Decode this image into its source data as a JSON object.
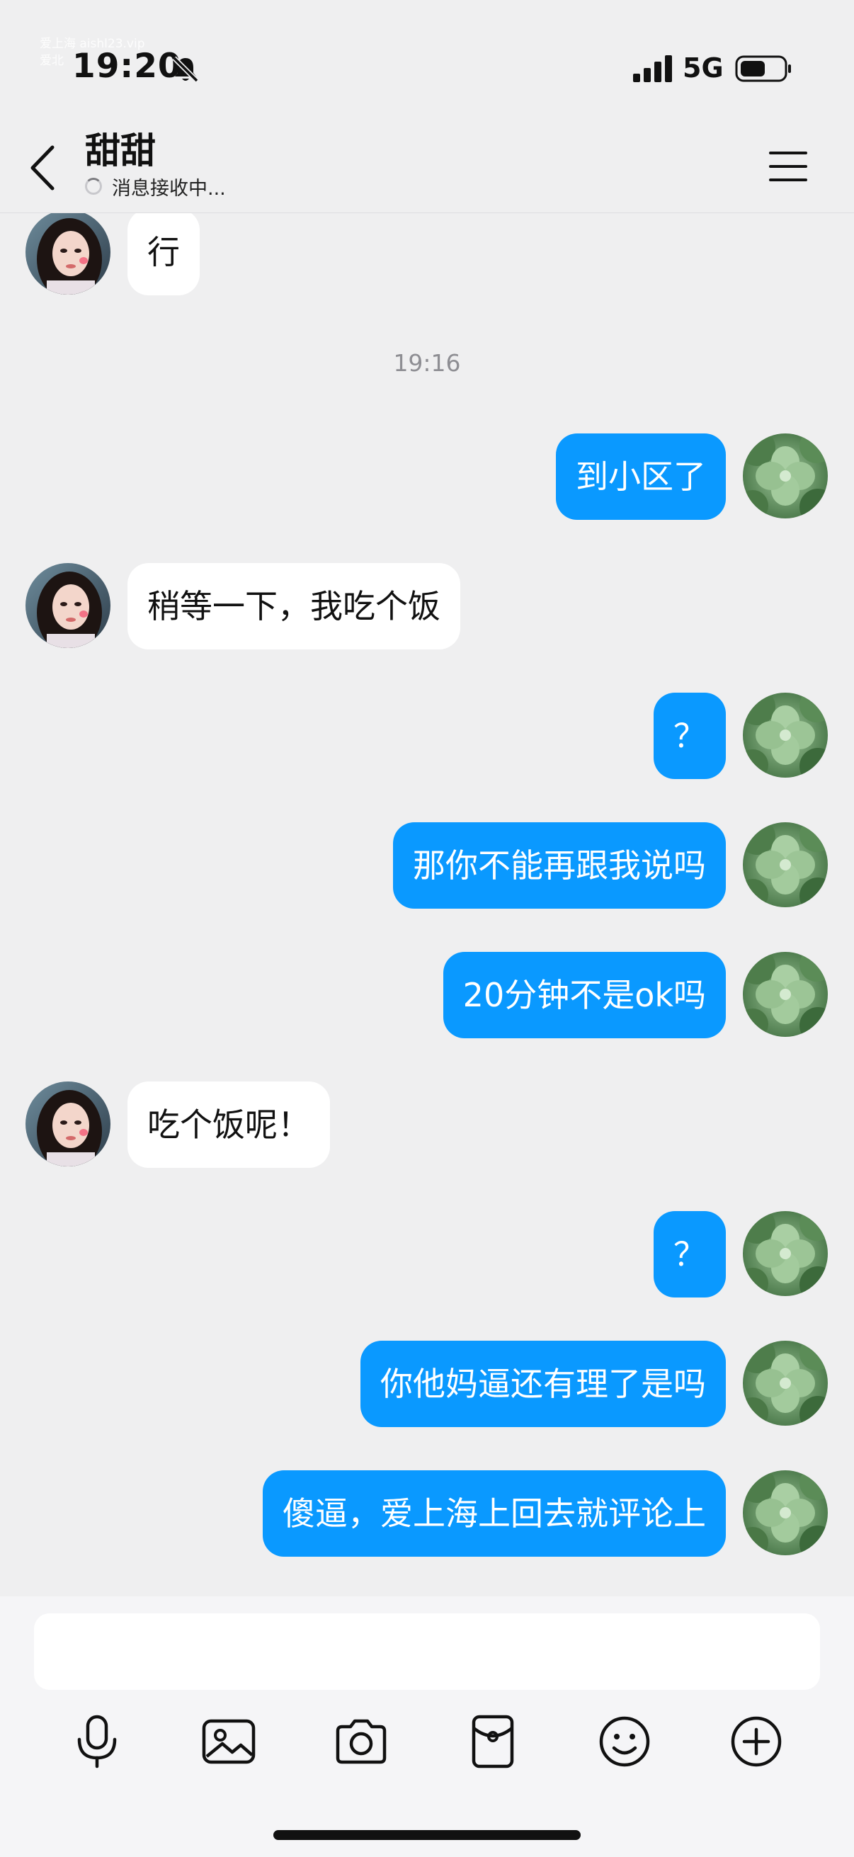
{
  "status_bar": {
    "watermark_line1": "爱上海 aishl23.vip",
    "watermark_line2": "爱北",
    "time": "19:20",
    "network": "5G",
    "bell_icon": "bell-slash-icon",
    "signal_icon": "signal-bars-icon",
    "battery_icon": "battery-icon"
  },
  "header": {
    "title": "甜甜",
    "status": "消息接收中...",
    "back_icon": "chevron-left-icon",
    "menu_icon": "hamburger-menu-icon"
  },
  "messages": [
    {
      "side": "left",
      "text": "行"
    },
    {
      "type": "timestamp",
      "text": "19:16"
    },
    {
      "side": "right",
      "text": "到小区了"
    },
    {
      "side": "left",
      "text": "稍等一下，我吃个饭"
    },
    {
      "side": "right",
      "text": "？"
    },
    {
      "side": "right",
      "text": "那你不能再跟我说吗"
    },
    {
      "side": "right",
      "text": "20分钟不是ok吗"
    },
    {
      "side": "left",
      "text": "吃个饭呢！"
    },
    {
      "side": "right",
      "text": "？"
    },
    {
      "side": "right",
      "text": "你他妈逼还有理了是吗"
    },
    {
      "side": "right",
      "text": "傻逼，爱上海上回去就评论上"
    }
  ],
  "input": {
    "value": "",
    "placeholder": ""
  },
  "toolbar": [
    {
      "icon": "microphone-icon"
    },
    {
      "icon": "image-icon"
    },
    {
      "icon": "camera-icon"
    },
    {
      "icon": "red-packet-icon"
    },
    {
      "icon": "emoji-icon"
    },
    {
      "icon": "plus-circle-icon"
    }
  ],
  "colors": {
    "background": "#efeff0",
    "sent_bubble": "#0a99ff",
    "received_bubble": "#ffffff",
    "timestamp": "#8e8e93"
  }
}
